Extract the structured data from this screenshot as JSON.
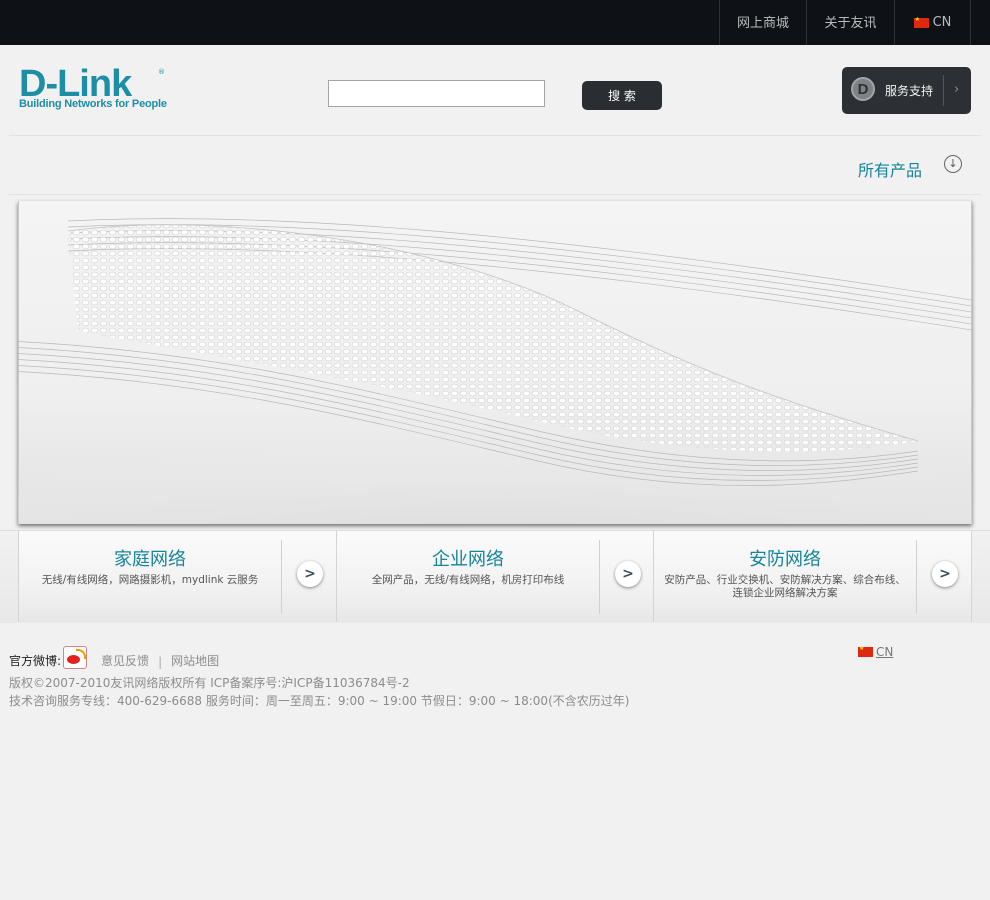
{
  "topnav": {
    "shop": "网上商城",
    "about": "关于友讯",
    "lang": "CN"
  },
  "logo": {
    "word": "D-Link",
    "tagline": "Building Networks for People"
  },
  "search": {
    "placeholder": "",
    "button": "搜 索"
  },
  "support": {
    "label": "服务支持"
  },
  "all_products": "所有产品",
  "categories": [
    {
      "title": "家庭网络",
      "desc": "无线/有线网络，网路摄影机，mydlink 云服务"
    },
    {
      "title": "企业网络",
      "desc": "全网产品，无线/有线网络，机房打印布线"
    },
    {
      "title": "安防网络",
      "desc": "安防产品、行业交换机、安防解决方案、综合布线、连锁企业网络解决方案"
    }
  ],
  "footer": {
    "weibo_label": "官方微博:",
    "feedback": "意见反馈",
    "sitemap": "网站地图",
    "copyright": "版权©2007-2010友讯网络版权所有 ICP备案序号:沪ICP备11036784号-2",
    "hotline": "技术咨询服务专线：400-629-6688 服务时间：周一至周五：9:00 ~ 19:00 节假日：9:00 ~ 18:00(不含农历过年)",
    "lang": "CN"
  },
  "colors": {
    "topbar": "#0e1115",
    "accent": "#16849a",
    "button_dark": "#2a2e33"
  }
}
